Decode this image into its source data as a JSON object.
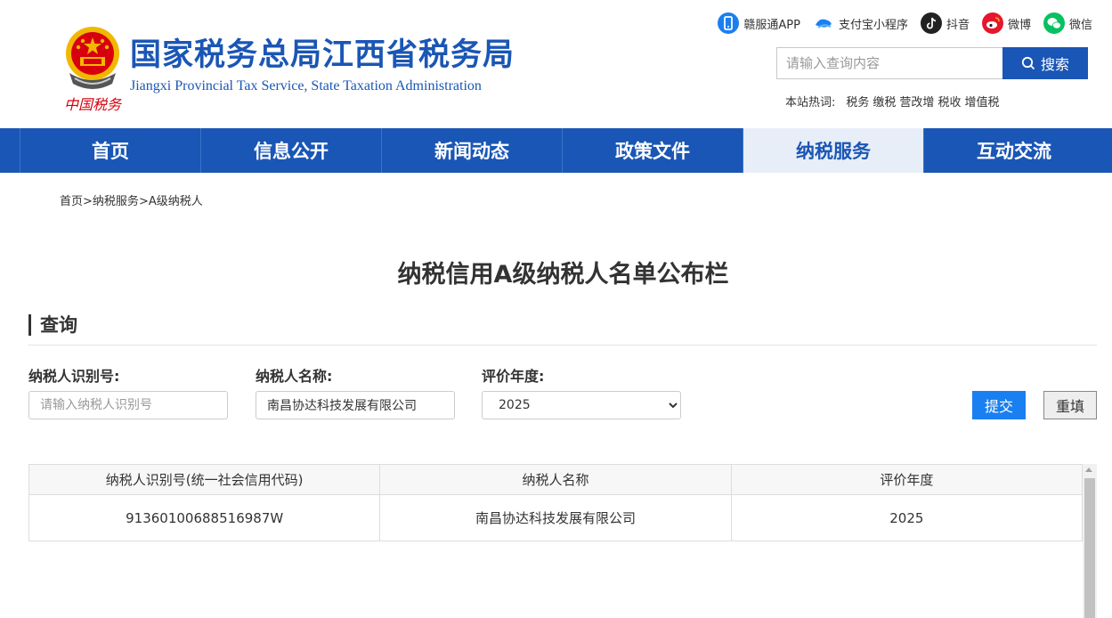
{
  "header": {
    "title": "国家税务总局江西省税务局",
    "subtitle": "Jiangxi Provincial Tax Service, State Taxation Administration",
    "emblem_text": "中国税务",
    "social": [
      {
        "label": "赣服通APP",
        "icon": "app-icon",
        "color": "#1a7ff0"
      },
      {
        "label": "支付宝小程序",
        "icon": "alipay-icon",
        "color": "#1a7ff0"
      },
      {
        "label": "抖音",
        "icon": "douyin-icon",
        "color": "#222222"
      },
      {
        "label": "微博",
        "icon": "weibo-icon",
        "color": "#e6162d"
      },
      {
        "label": "微信",
        "icon": "wechat-icon",
        "color": "#07c160"
      }
    ],
    "search": {
      "placeholder": "请输入查询内容",
      "button": "搜索"
    },
    "hotwords": {
      "label": "本站热词:",
      "words": [
        "税务",
        "缴税",
        "营改增",
        "税收",
        "增值税"
      ]
    }
  },
  "nav": {
    "items": [
      "首页",
      "信息公开",
      "新闻动态",
      "政策文件",
      "纳税服务",
      "互动交流"
    ],
    "active": "纳税服务"
  },
  "breadcrumb": [
    "首页",
    "纳税服务",
    "A级纳税人"
  ],
  "page_title": "纳税信用A级纳税人名单公布栏",
  "query": {
    "section_title": "查询",
    "taxpayer_id": {
      "label": "纳税人识别号:",
      "placeholder": "请输入纳税人识别号",
      "value": ""
    },
    "taxpayer_name": {
      "label": "纳税人名称:",
      "placeholder": "",
      "value": "南昌协达科技发展有限公司"
    },
    "year": {
      "label": "评价年度:",
      "value": "2025"
    },
    "submit": "提交",
    "reset": "重填"
  },
  "results": {
    "columns": [
      "纳税人识别号(统一社会信用代码)",
      "纳税人名称",
      "评价年度"
    ],
    "rows": [
      [
        "91360100688516987W",
        "南昌协达科技发展有限公司",
        "2025"
      ]
    ]
  },
  "colors": {
    "brand": "#1a56b5",
    "submit": "#1a7ff0",
    "emblem_red": "#d7000f",
    "emblem_gold": "#f2b700"
  }
}
